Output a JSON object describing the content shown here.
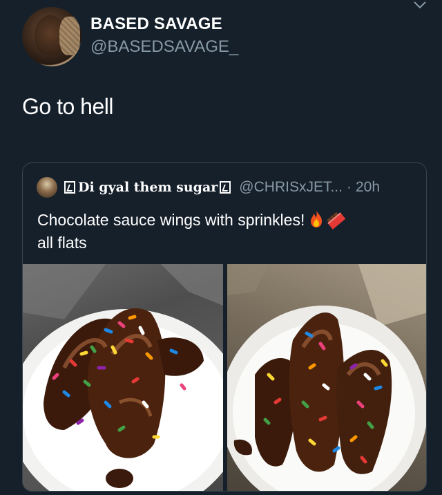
{
  "tweet": {
    "display_name": "BASED SAVAGE",
    "handle": "@BASEDSAVAGE_",
    "text": "Go to hell"
  },
  "quoted_tweet": {
    "display_name": "Di gyal them sugar",
    "handle": "@CHRISxJET...",
    "separator": "·",
    "time": "20h",
    "text_line1": "Chocolate sauce wings with sprinkles!",
    "text_line2": "all flats",
    "emojis": [
      "fire-emoji",
      "chocolate-bar-emoji"
    ],
    "images": [
      "wings-photo-left",
      "wings-photo-right"
    ]
  },
  "colors": {
    "background": "#15202b",
    "primary_text": "#ffffff",
    "secondary_text": "#8899a6",
    "border": "#38444d"
  },
  "icons": {
    "menu": "chevron-down-icon"
  }
}
